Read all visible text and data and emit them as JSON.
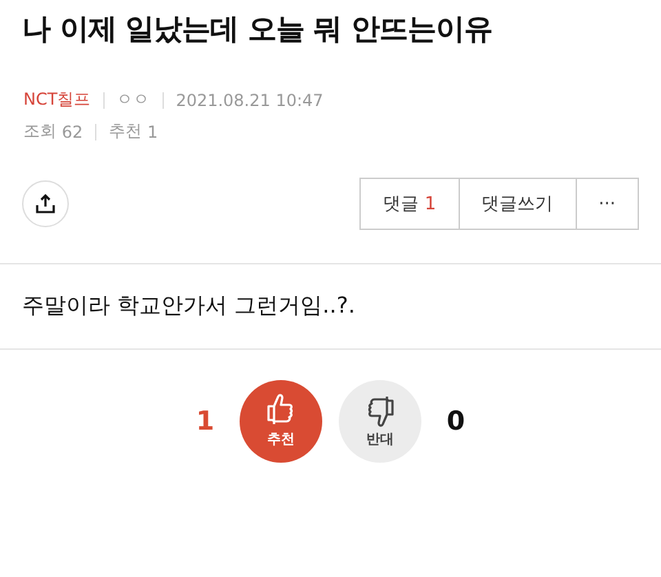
{
  "post": {
    "title": "나 이제 일났는데 오늘 뭐 안뜨는이유",
    "author": "NCT칠프",
    "author_tag": "ㅇㅇ",
    "date": "2021.08.21 10:47",
    "views_label": "조회",
    "views": "62",
    "likes_label": "추천",
    "likes": "1"
  },
  "actions": {
    "comments_label": "댓글",
    "comments_count": "1",
    "write_comment": "댓글쓰기",
    "more": "···"
  },
  "body": "주말이라 학교안가서 그런거임..?.",
  "votes": [
    {
      "count": "1",
      "label": "추천",
      "kind": "up",
      "selected": true
    },
    {
      "count": "0",
      "label": "반대",
      "kind": "down",
      "selected": false
    }
  ]
}
